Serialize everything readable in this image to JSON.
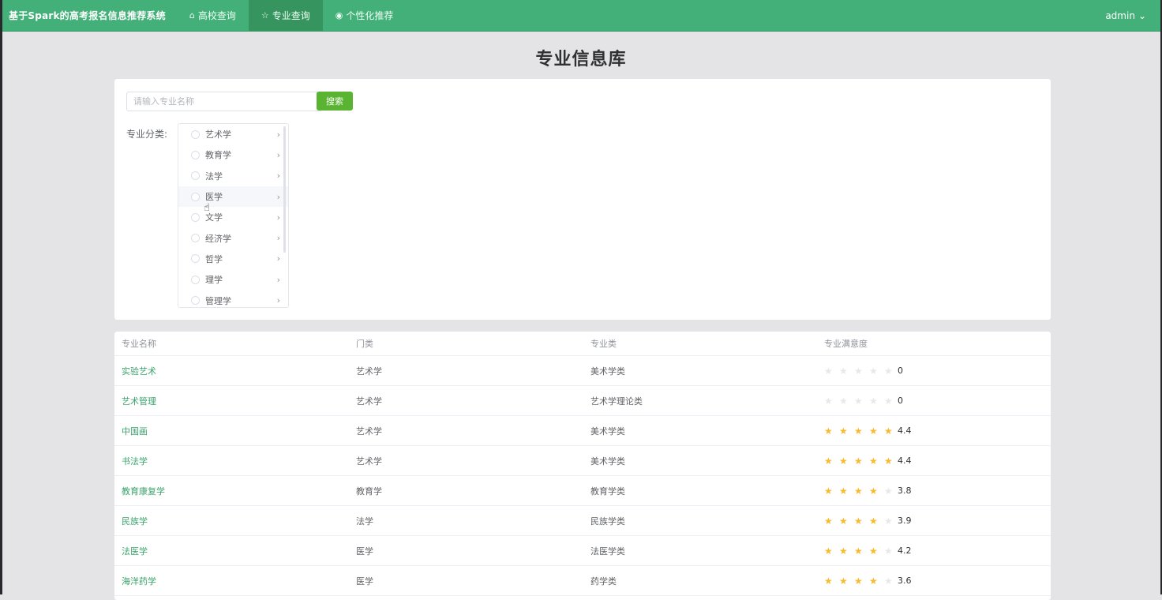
{
  "nav": {
    "brand": "基于Spark的高考报名信息推荐系统",
    "items": [
      {
        "label": "高校查询",
        "icon": "building-icon",
        "glyph": "⌂"
      },
      {
        "label": "专业查询",
        "icon": "star-outline-icon",
        "glyph": "☆"
      },
      {
        "label": "个性化推荐",
        "icon": "target-icon",
        "glyph": "◉"
      }
    ],
    "active_index": 1,
    "user": "admin",
    "user_chevron": "⌄"
  },
  "page": {
    "title": "专业信息库"
  },
  "search": {
    "placeholder": "请输入专业名称",
    "value": "",
    "button_label": "搜索"
  },
  "category": {
    "label": "专业分类:",
    "options": [
      "艺术学",
      "教育学",
      "法学",
      "医学",
      "文学",
      "经济学",
      "哲学",
      "理学",
      "管理学"
    ],
    "hover_index": 3
  },
  "table": {
    "headers": [
      "专业名称",
      "门类",
      "专业类",
      "专业满意度"
    ],
    "rows": [
      {
        "name": "实验艺术",
        "category": "艺术学",
        "subclass": "美术学类",
        "rating": 0,
        "score": "0"
      },
      {
        "name": "艺术管理",
        "category": "艺术学",
        "subclass": "艺术学理论类",
        "rating": 0,
        "score": "0"
      },
      {
        "name": "中国画",
        "category": "艺术学",
        "subclass": "美术学类",
        "rating": 4.4,
        "score": "4.4"
      },
      {
        "name": "书法学",
        "category": "艺术学",
        "subclass": "美术学类",
        "rating": 4.4,
        "score": "4.4"
      },
      {
        "name": "教育康复学",
        "category": "教育学",
        "subclass": "教育学类",
        "rating": 3.8,
        "score": "3.8"
      },
      {
        "name": "民族学",
        "category": "法学",
        "subclass": "民族学类",
        "rating": 3.9,
        "score": "3.9"
      },
      {
        "name": "法医学",
        "category": "医学",
        "subclass": "法医学类",
        "rating": 4.2,
        "score": "4.2"
      },
      {
        "name": "海洋药学",
        "category": "医学",
        "subclass": "药学类",
        "rating": 3.6,
        "score": "3.6"
      }
    ]
  },
  "colors": {
    "nav": "#42b078",
    "accent": "#5ab431",
    "link": "#3aa36b",
    "star": "#f7ba2a"
  }
}
